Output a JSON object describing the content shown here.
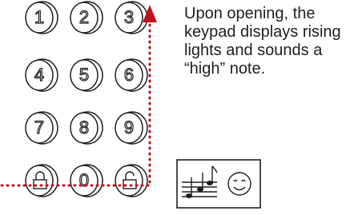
{
  "caption": "Upon opening, the keypad displays rising lights and sounds a “high” note.",
  "keypad": {
    "keys": [
      "1",
      "2",
      "3",
      "4",
      "5",
      "6",
      "7",
      "8",
      "9",
      "",
      "0",
      ""
    ],
    "bottom_icons": [
      "lock-icon",
      "unlock-icon"
    ]
  },
  "arrow": {
    "direction": "up",
    "style": "dotted",
    "color": "#c0121c"
  },
  "sound_icon": {
    "notes": "rising-music-notes-icon",
    "face": "smiley-face-icon"
  },
  "colors": {
    "ink": "#1e1e1e",
    "accent": "#c0121c",
    "background": "#ffffff"
  }
}
